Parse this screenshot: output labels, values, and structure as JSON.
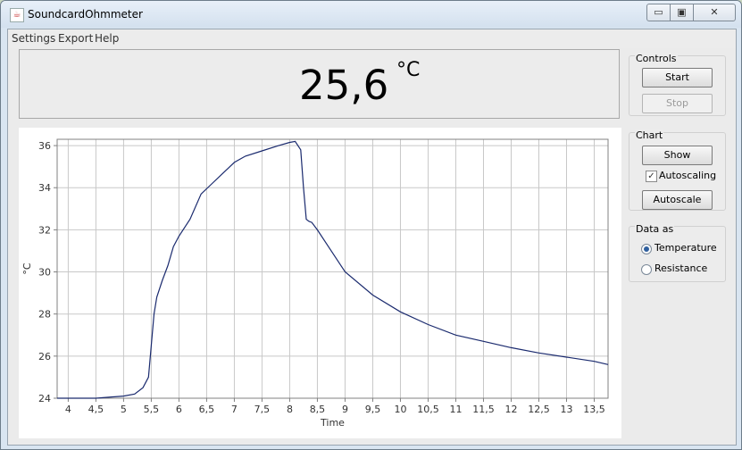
{
  "window": {
    "title": "SoundcardOhmmeter",
    "minimize": "▭",
    "maximize": "▣",
    "close": "✕"
  },
  "menu": {
    "items": [
      "Settings",
      "Export",
      "Help"
    ]
  },
  "readout": {
    "value": "25,6",
    "unit": "°C"
  },
  "controls": {
    "title": "Controls",
    "start": "Start",
    "stop": "Stop"
  },
  "chart_panel": {
    "title": "Chart",
    "show": "Show",
    "autoscaling_label": "Autoscaling",
    "autoscaling_checked": true,
    "autoscale": "Autoscale"
  },
  "data_as": {
    "title": "Data as",
    "options": [
      "Temperature",
      "Resistance"
    ],
    "selected": "Temperature"
  },
  "chart_data": {
    "type": "line",
    "xlabel": "Time",
    "ylabel": "°C",
    "xlim": [
      3.8,
      13.75
    ],
    "ylim": [
      24,
      36.3
    ],
    "x_ticks": [
      4,
      4.5,
      5,
      5.5,
      6,
      6.5,
      7,
      7.5,
      8,
      8.5,
      9,
      9.5,
      10,
      10.5,
      11,
      11.5,
      12,
      12.5,
      13,
      13.5
    ],
    "x_tick_labels": [
      "4",
      "4,5",
      "5",
      "5,5",
      "6",
      "6,5",
      "7",
      "7,5",
      "8",
      "8,5",
      "9",
      "9,5",
      "10",
      "10,5",
      "11",
      "11,5",
      "12",
      "12,5",
      "13",
      "13,5"
    ],
    "y_ticks": [
      24,
      26,
      28,
      30,
      32,
      34,
      36
    ],
    "y_tick_labels": [
      "24",
      "26",
      "28",
      "30",
      "32",
      "34",
      "36"
    ],
    "grid": true,
    "line_color": "#1a2a6e",
    "series": [
      {
        "x": [
          3.8,
          4.5,
          5.0,
          5.2,
          5.35,
          5.45,
          5.5,
          5.55,
          5.6,
          5.7,
          5.8,
          5.9,
          6.0,
          6.2,
          6.4,
          6.6,
          6.8,
          7.0,
          7.2,
          7.5,
          7.8,
          8.0,
          8.1,
          8.2,
          8.25,
          8.3,
          8.35,
          8.4,
          8.5,
          8.7,
          9.0,
          9.5,
          10.0,
          10.5,
          11.0,
          11.5,
          12.0,
          12.5,
          13.0,
          13.5,
          13.75
        ],
        "y": [
          24.0,
          24.0,
          24.1,
          24.2,
          24.5,
          25.0,
          26.5,
          28.0,
          28.8,
          29.6,
          30.3,
          31.2,
          31.7,
          32.5,
          33.7,
          34.2,
          34.7,
          35.2,
          35.5,
          35.75,
          36.0,
          36.15,
          36.2,
          35.8,
          34.0,
          32.5,
          32.4,
          32.35,
          32.0,
          31.2,
          30.0,
          28.9,
          28.1,
          27.5,
          27.0,
          26.7,
          26.4,
          26.15,
          25.95,
          25.75,
          25.6
        ]
      }
    ]
  }
}
